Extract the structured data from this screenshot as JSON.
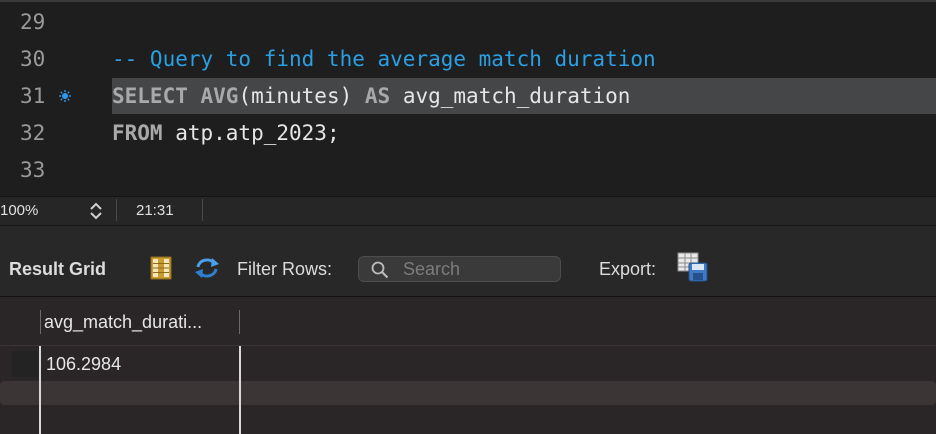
{
  "editor": {
    "lines": [
      {
        "number": "29",
        "code": ""
      },
      {
        "number": "30",
        "comment": "-- Query to find the average match duration"
      },
      {
        "number": "31",
        "kw1": "SELECT",
        "fn": "AVG",
        "rest1": "(minutes) ",
        "kw2": "AS",
        "rest2": " avg_match_duration"
      },
      {
        "number": "32",
        "kw1": "FROM",
        "rest1": " atp.atp_2023;"
      },
      {
        "number": "33",
        "code": ""
      }
    ],
    "current_line": "31"
  },
  "statusbar": {
    "zoom": "100%",
    "cursor_position": "21:31"
  },
  "results_toolbar": {
    "result_grid_label": "Result Grid",
    "filter_rows_label": "Filter Rows:",
    "search_placeholder": "Search",
    "export_label": "Export:"
  },
  "grid": {
    "columns": [
      "avg_match_durati..."
    ],
    "rows": [
      [
        "106.2984"
      ]
    ]
  },
  "colors": {
    "comment": "#2b9fe3",
    "keyword": "#a9a9a9",
    "current_line_bg": "#444648",
    "marker": "#2f9bf0"
  }
}
